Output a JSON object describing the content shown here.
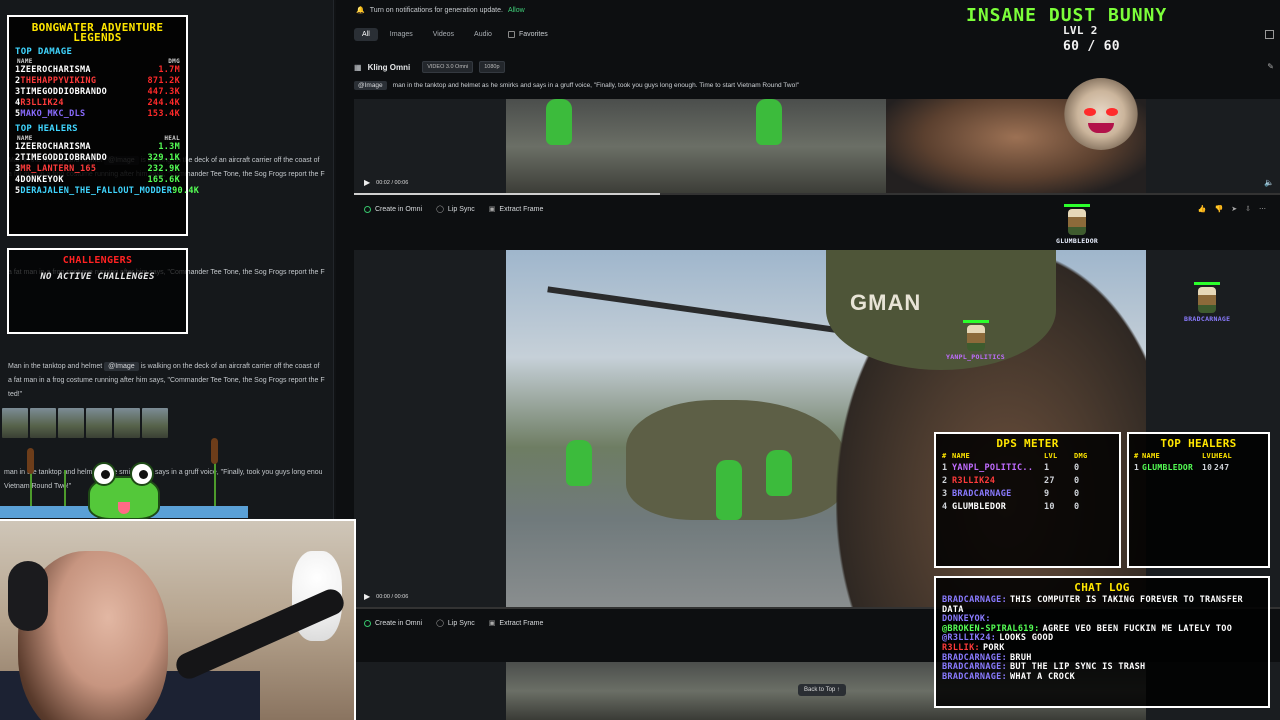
{
  "notification": {
    "text": "Turn on notifications for generation update.",
    "allow": "Allow"
  },
  "filters": {
    "tabs": [
      "All",
      "Images",
      "Videos",
      "Audio"
    ],
    "favorites": "Favorites"
  },
  "generation": {
    "model": "Kling Omni",
    "version_tag": "VIDEO 3.0 Omni",
    "resolution_tag": "1080p",
    "image_chip": "@Image",
    "prompt": "man in the tanktop and helmet as he smirks and says in a gruff voice, \"Finally, took you guys long enough. Time to start Vietnam Round Two!\"",
    "helmet_text": "GMAN"
  },
  "videos": [
    {
      "time": "00:02 / 00:06",
      "progress": 0.33
    },
    {
      "time": "00:00 / 00:06",
      "progress": 0.0
    }
  ],
  "actions": {
    "create": "Create in Omni",
    "lipsync": "Lip Sync",
    "extract": "Extract Frame"
  },
  "back_to_top": "Back to Top",
  "left_messages": {
    "prefix": "Man in the tanktop and helmet",
    "chip": "@Image",
    "line1": "is walking on the deck of an aircraft carrier off the coast of",
    "line2": "a fat man in a frog costume running after him says, \"Commander Tee Tone, the Sog Frogs report the F Box",
    "line3": "ted!\"",
    "line4": "man in the tanktop and helmet as he smirks and says in a gruff voice, \"Finally, took you guys long enough.",
    "line5": "Vietnam Round Two!\""
  },
  "leaderboard": {
    "title": "BONGWATER ADVENTURE LEGENDS",
    "damage_title": "TOP DAMAGE",
    "damage_head": {
      "name": "NAME",
      "stat": "DMG"
    },
    "damage": [
      {
        "rank": "1",
        "name": "ZEEROCHARISMA",
        "value": "1.7M",
        "color": "#ffffff"
      },
      {
        "rank": "2",
        "name": "THEHAPPYVIKING",
        "value": "871.2K",
        "color": "#ff3b3b"
      },
      {
        "rank": "3",
        "name": "TIMEGODDIOBRANDO",
        "value": "447.3K",
        "color": "#ffffff"
      },
      {
        "rank": "4",
        "name": "R3LLIK24",
        "value": "244.4K",
        "color": "#ff3b3b"
      },
      {
        "rank": "5",
        "name": "MAKO_MKC_DLS",
        "value": "153.4K",
        "color": "#8a6cff"
      }
    ],
    "heal_title": "TOP HEALERS",
    "heal_head": {
      "name": "NAME",
      "stat": "HEAL"
    },
    "healers": [
      {
        "rank": "1",
        "name": "ZEEROCHARISMA",
        "value": "1.3M",
        "color": "#ffffff"
      },
      {
        "rank": "2",
        "name": "TIMEGODDIOBRANDO",
        "value": "329.1K",
        "color": "#ffffff"
      },
      {
        "rank": "3",
        "name": "MR_LANTERN_165",
        "value": "232.9K",
        "color": "#ff3b3b"
      },
      {
        "rank": "4",
        "name": "DONKEYOK",
        "value": "165.6K",
        "color": "#ffffff"
      },
      {
        "rank": "5",
        "name": "DERAJALEN_THE_FALLOUT_MODDER",
        "value": "90.4K",
        "color": "#40d6ff"
      }
    ]
  },
  "challenges": {
    "title": "CHALLENGERS",
    "empty": "NO ACTIVE CHALLENGES"
  },
  "boss": {
    "name": "INSANE DUST BUNNY",
    "level": "LVL 2",
    "hp": "60 / 60"
  },
  "players": [
    {
      "name": "GLUMBLEDOR",
      "color": "#ffffff"
    },
    {
      "name": "BRADCARNAGE",
      "color": "#8a7bff"
    },
    {
      "name": "YANPL_POLITICS",
      "color": "#c06cff"
    }
  ],
  "dps": {
    "title": "DPS METER",
    "head": {
      "name": "NAME",
      "lvl": "LVL",
      "dmg": "DMG"
    },
    "rows": [
      {
        "rank": "1",
        "name": "YANPL_POLITIC..",
        "lvl": "1",
        "dmg": "0",
        "color": "#c06cff"
      },
      {
        "rank": "2",
        "name": "R3LLIK24",
        "lvl": "27",
        "dmg": "0",
        "color": "#ff3b3b"
      },
      {
        "rank": "3",
        "name": "BRADCARNAGE",
        "lvl": "9",
        "dmg": "0",
        "color": "#8a7bff"
      },
      {
        "rank": "4",
        "name": "GLUMBLEDOR",
        "lvl": "10",
        "dmg": "0",
        "color": "#ffffff"
      }
    ]
  },
  "healers_box": {
    "title": "TOP HEALERS",
    "head": {
      "name": "NAME",
      "lvl": "LVL",
      "heal": "HEAL"
    },
    "rows": [
      {
        "rank": "1",
        "name": "GLUMBLEDOR",
        "lvl": "10",
        "heal": "247",
        "color": "#55ff55"
      }
    ]
  },
  "chat": {
    "title": "CHAT LOG",
    "lines": [
      {
        "who": "BRADCARNAGE:",
        "msg": "THIS COMPUTER IS TAKING FOREVER TO TRANSFER DATA",
        "color": "#8a7bff"
      },
      {
        "who": "DONKEYOK:",
        "msg": "",
        "color": "#8a7bff"
      },
      {
        "who": "@BROKEN-SPIRAL619:",
        "msg": "AGREE VEO BEEN FUCKIN ME LATELY TOO",
        "color": "#55ff55"
      },
      {
        "who": "@R3LLIK24:",
        "msg": "LOOKS GOOD",
        "color": "#8a7bff"
      },
      {
        "who": "R3LLIK:",
        "msg": "PORK",
        "color": "#ff3b3b"
      },
      {
        "who": "BRADCARNAGE:",
        "msg": "BRUH",
        "color": "#8a7bff"
      },
      {
        "who": "BRADCARNAGE:",
        "msg": "BUT THE LIP SYNC IS TRASH",
        "color": "#8a7bff"
      },
      {
        "who": "BRADCARNAGE:",
        "msg": "WHAT A CROCK",
        "color": "#8a7bff"
      }
    ]
  },
  "icons": [
    "bell-icon",
    "grid-icon",
    "edit-icon",
    "play-icon",
    "volume-icon",
    "thumbs-up-icon",
    "thumbs-down-icon",
    "share-icon",
    "more-icon",
    "arrow-up-icon"
  ]
}
